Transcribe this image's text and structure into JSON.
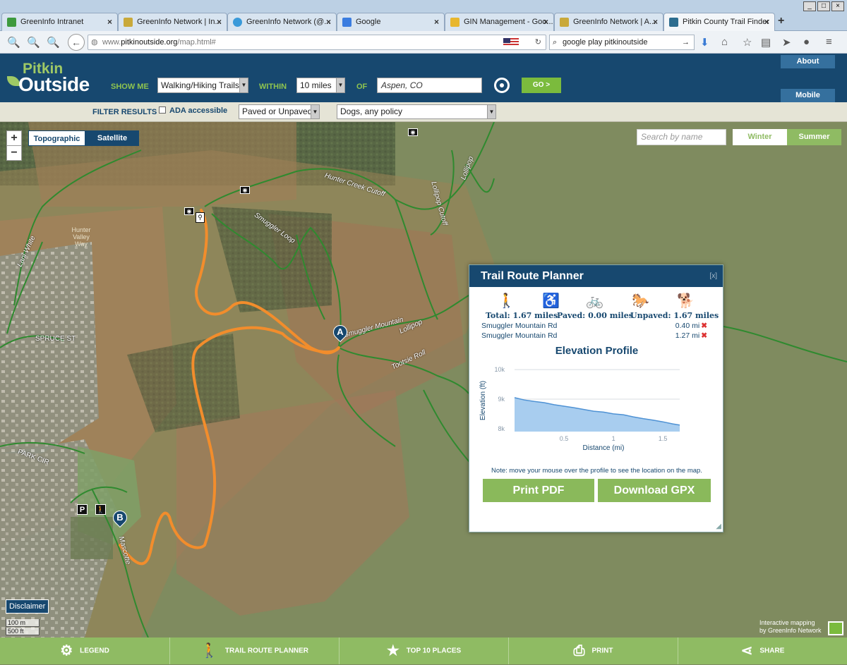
{
  "browser": {
    "tabs": [
      {
        "label": "GreenInfo Intranet",
        "color": "#3e9a3e"
      },
      {
        "label": "GreenInfo Network | In...",
        "color": "#c9a93a"
      },
      {
        "label": "GreenInfo Network (@...",
        "color": "#3a9ad9"
      },
      {
        "label": "Google",
        "color": "#3b7de0"
      },
      {
        "label": "GIN Management - Goo...",
        "color": "#e8b72e"
      },
      {
        "label": "GreenInfo Network | A...",
        "color": "#c9a93a"
      },
      {
        "label": "Pitkin County Trail Finder",
        "color": "#2d6d8f"
      }
    ],
    "url_prefix": "www.",
    "url_domain": "pitkinoutside.org",
    "url_path": "/map.html#",
    "search_query": "google play pitkinoutside"
  },
  "header": {
    "logo_top": "Pitkin",
    "logo_bottom": "Outside",
    "show_me_label": "SHOW ME",
    "show_me_value": "Walking/Hiking Trails",
    "within_label": "WITHIN",
    "within_value": "10 miles",
    "of_label": "OF",
    "location_value": "Aspen, CO",
    "go_label": "GO >",
    "about_label": "About",
    "mobile_label": "Mobile"
  },
  "filter": {
    "label": "FILTER RESULTS",
    "ada_label": "ADA accessible",
    "surface_value": "Paved or Unpaved",
    "dogs_value": "Dogs, any policy"
  },
  "map": {
    "zoom_in": "+",
    "zoom_out": "−",
    "basemap_topo": "Topographic",
    "basemap_sat": "Satellite",
    "search_placeholder": "Search by name",
    "season_winter": "Winter",
    "season_summer": "Summer",
    "disclaimer": "Disclaimer",
    "scale_m": "100 m",
    "scale_ft": "500 ft",
    "credit_line1": "Interactive mapping",
    "credit_line2": "by GreenInfo Network",
    "marker_a": "A",
    "marker_b": "B",
    "trail_labels": [
      "Hunter Creek Cutoff",
      "Lollipop",
      "Lollipop Cutoff",
      "Smuggler Loop",
      "Lani White",
      "SPRUCE ST",
      "PARK CIR",
      "Mascotte",
      "Lollipop",
      "Tootsie Roll",
      "Smuggler Mountain",
      "Hunter Valley Way"
    ],
    "icons": {
      "photo": "camera-icon",
      "info": "pin-icon",
      "parking": "P"
    }
  },
  "planner": {
    "title": "Trail Route Planner",
    "close": "[x]",
    "total": "Total: 1.67 miles",
    "paved": "Paved: 0.00 miles",
    "unpaved": "Unpaved: 1.67 miles",
    "segments": [
      {
        "name": "Smuggler Mountain Rd",
        "dist": "0.40 mi"
      },
      {
        "name": "Smuggler Mountain Rd",
        "dist": "1.27 mi"
      }
    ],
    "remove_icon": "✖",
    "elevation_title": "Elevation Profile",
    "note": "Note: move your mouse over the profile to see the location on the map.",
    "print_label": "Print PDF",
    "gpx_label": "Download GPX"
  },
  "chart_data": {
    "type": "area",
    "title": "",
    "xlabel": "Distance (mi)",
    "ylabel": "Elevation (ft)",
    "xlim": [
      0,
      1.67
    ],
    "ylim": [
      7900,
      10050
    ],
    "xticks": [
      0.5,
      1,
      1.5
    ],
    "xtick_labels": [
      "0.5",
      "1",
      "1.5"
    ],
    "yticks": [
      8000,
      9000,
      10000
    ],
    "ytick_labels": [
      "8k",
      "9k",
      "10k"
    ],
    "x": [
      0,
      0.1,
      0.2,
      0.3,
      0.4,
      0.5,
      0.6,
      0.7,
      0.8,
      0.9,
      1.0,
      1.1,
      1.2,
      1.3,
      1.4,
      1.5,
      1.6,
      1.67
    ],
    "series": [
      {
        "values": [
          9050,
          8970,
          8920,
          8880,
          8810,
          8760,
          8710,
          8650,
          8590,
          8560,
          8500,
          8470,
          8400,
          8340,
          8290,
          8230,
          8160,
          8120
        ]
      }
    ],
    "grid": true,
    "colors": {
      "fill": "#a8cdef",
      "line": "#4f92d4"
    }
  },
  "bottom": {
    "legend": "LEGEND",
    "planner": "TRAIL ROUTE PLANNER",
    "top10": "TOP 10 PLACES",
    "print": "PRINT",
    "share": "SHARE"
  },
  "colors": {
    "header_bg": "#17486f",
    "accent_green": "#8fbb63",
    "route": "#f28d2c",
    "trail": "#2f8a2f"
  }
}
